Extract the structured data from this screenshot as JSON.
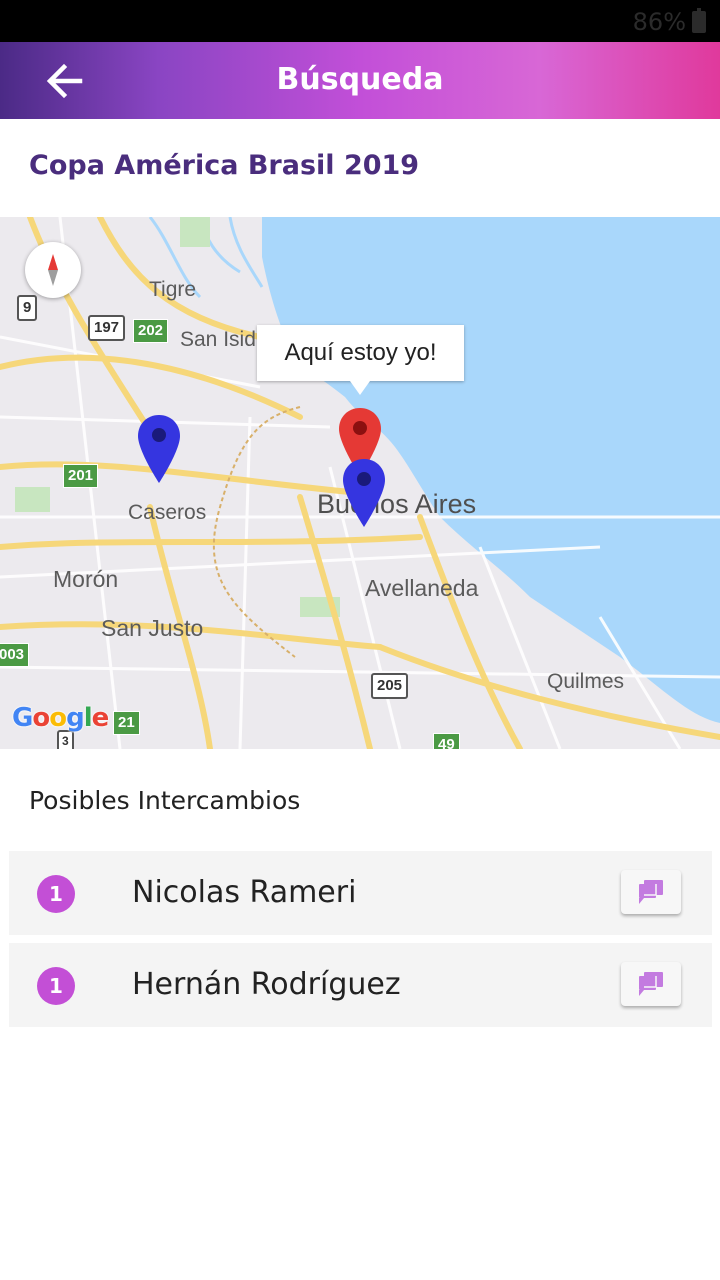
{
  "status_bar": {
    "battery": "86%"
  },
  "app_bar": {
    "title": "Búsqueda"
  },
  "event": {
    "name": "Copa América Brasil 2019"
  },
  "map": {
    "info_window": "Aquí estoy yo!",
    "labels": {
      "tigre": "Tigre",
      "san_isidro": "San Isidr",
      "caseros": "Caseros",
      "buenos_aires": "Buenos Aires",
      "moron": "Morón",
      "san_justo": "San Justo",
      "avellaneda": "Avellaneda",
      "quilmes": "Quilmes"
    },
    "shields": {
      "r9": "9",
      "r197": "197",
      "r202": "202",
      "r201": "201",
      "r003": "003",
      "r205": "205",
      "r21": "21",
      "r3": "3",
      "r49": "49"
    },
    "attribution": "Google",
    "pin_colors": {
      "user": "#e53935",
      "match": "#3535e0"
    }
  },
  "list": {
    "title": "Posibles Intercambios",
    "items": [
      {
        "count": "1",
        "name": "Nicolas Rameri"
      },
      {
        "count": "1",
        "name": "Hernán Rodríguez"
      }
    ]
  },
  "colors": {
    "accent": "#c34fd6",
    "title_purple": "#4a2d7d"
  }
}
